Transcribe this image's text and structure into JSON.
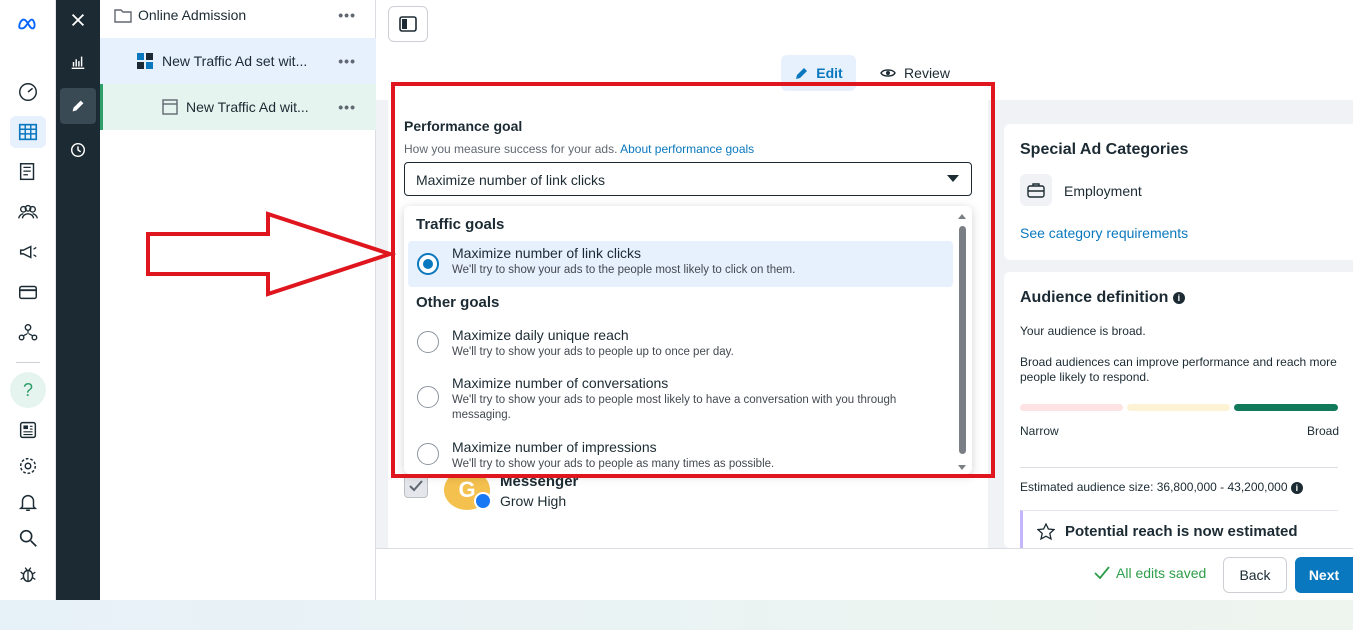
{
  "tree": {
    "items": [
      {
        "label": "Online Admission",
        "more": "•••"
      },
      {
        "label": "New Traffic Ad set wit...",
        "more": "•••"
      },
      {
        "label": "New Traffic Ad wit...",
        "more": "•••"
      }
    ]
  },
  "tabs": {
    "edit": "Edit",
    "review": "Review"
  },
  "performance_goal": {
    "title": "Performance goal",
    "subtitle": "How you measure success for your ads.",
    "link": "About performance goals",
    "selected": "Maximize number of link clicks",
    "groups": [
      {
        "label": "Traffic goals"
      },
      {
        "label": "Other goals"
      }
    ],
    "options": [
      {
        "title": "Maximize number of link clicks",
        "desc": "We'll try to show your ads to the people most likely to click on them.",
        "selected": true
      },
      {
        "title": "Maximize daily unique reach",
        "desc": "We'll try to show your ads to people up to once per day.",
        "selected": false
      },
      {
        "title": "Maximize number of conversations",
        "desc": "We'll try to show your ads to people most likely to have a conversation with you through messaging.",
        "selected": false
      },
      {
        "title": "Maximize number of impressions",
        "desc": "We'll try to show your ads to people as many times as possible.",
        "selected": false
      }
    ]
  },
  "messenger_row": {
    "avatar_letter": "G",
    "name": "Messenger",
    "page": "Grow High"
  },
  "special_ad": {
    "title": "Special Ad Categories",
    "category": "Employment",
    "link": "See category requirements"
  },
  "audience": {
    "title": "Audience definition",
    "status": "Your audience is broad.",
    "note": "Broad audiences can improve performance and reach more people likely to respond.",
    "narrow": "Narrow",
    "broad": "Broad",
    "estimated_label": "Estimated audience size:",
    "estimated_value": "36,800,000 - 43,200,000",
    "potential": "Potential reach is now estimated"
  },
  "footer": {
    "saved": "All edits saved",
    "back": "Back",
    "next": "Next"
  },
  "colors": {
    "accent": "#0a78be",
    "highlight": "#e0161f",
    "success": "#2e9e4a"
  }
}
